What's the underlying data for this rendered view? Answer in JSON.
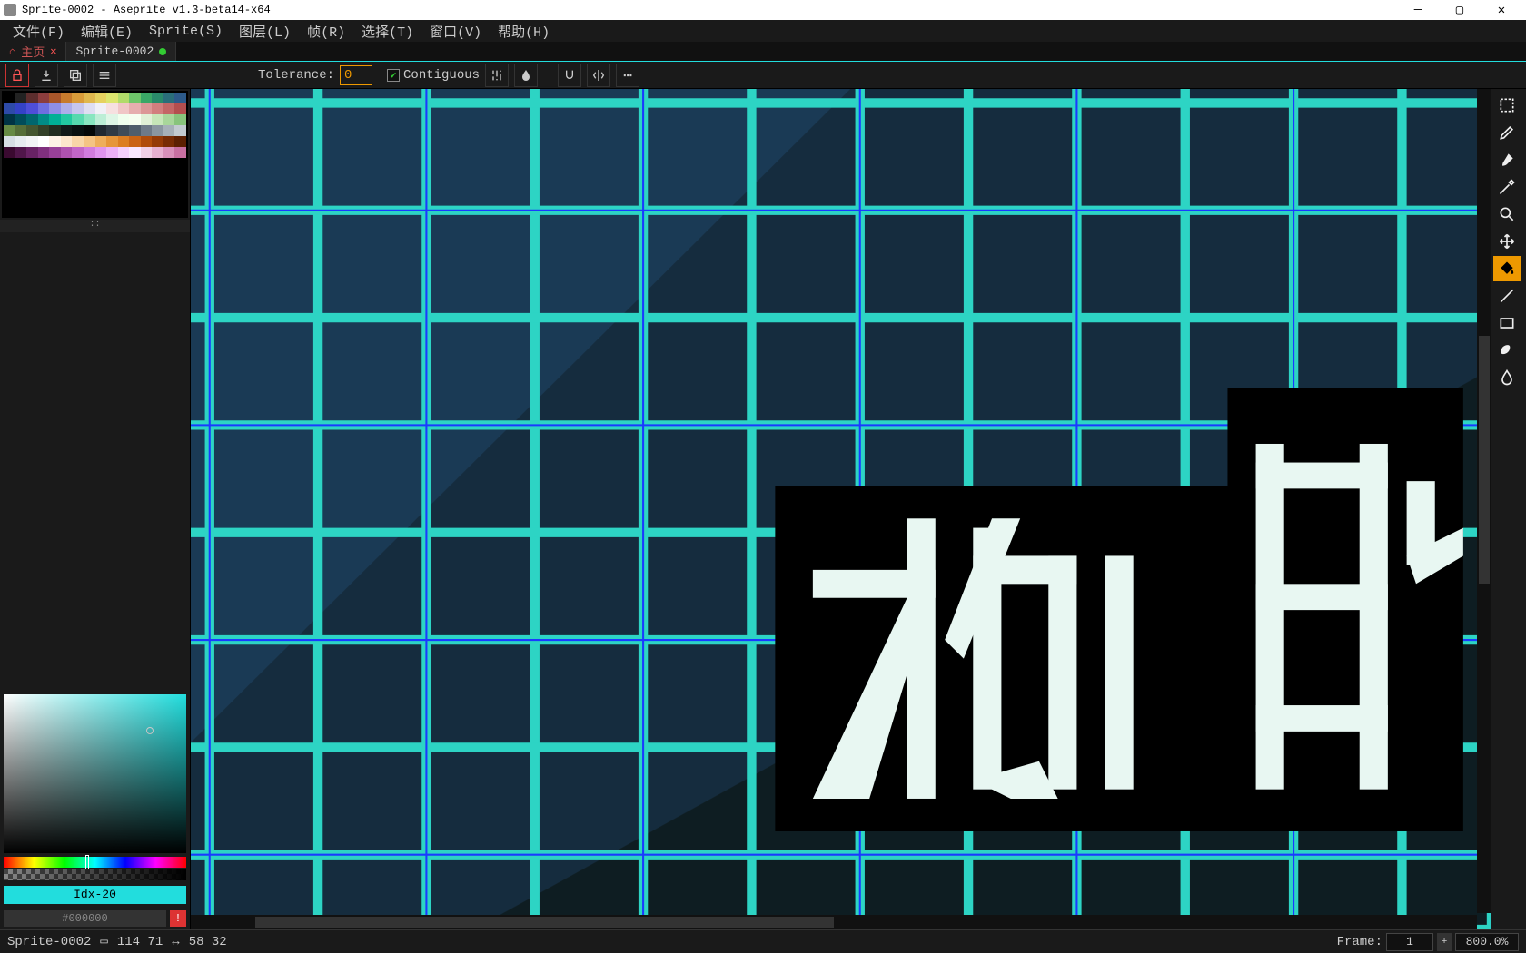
{
  "titlebar": {
    "title": "Sprite-0002 - Aseprite v1.3-beta14-x64"
  },
  "win": {
    "min": "—",
    "max": "▢",
    "close": "✕"
  },
  "menu": [
    "文件(F)",
    "编辑(E)",
    "Sprite(S)",
    "图层(L)",
    "帧(R)",
    "选择(T)",
    "窗口(V)",
    "帮助(H)"
  ],
  "tabs": {
    "home": {
      "label": "主页",
      "close": "✕"
    },
    "active": {
      "label": "Sprite-0002"
    }
  },
  "context": {
    "tolerance_label": "Tolerance:",
    "tolerance_value": "0",
    "contiguous_label": "Contiguous"
  },
  "palette": {
    "handle": "::"
  },
  "colorpanel": {
    "idx_label": "Idx-20",
    "hex": "#000000",
    "warn": "!"
  },
  "status": {
    "sprite": "Sprite-0002",
    "pos": "114 71",
    "sel": "58 32",
    "frame_label": "Frame:",
    "frame": "1",
    "plus": "+",
    "zoom": "800.0%"
  },
  "palette_colors": [
    "#000000",
    "#222222",
    "#5c2d2d",
    "#8b3d3d",
    "#a8562a",
    "#c77b2d",
    "#d99c3a",
    "#e0b84e",
    "#e6d25f",
    "#dce66e",
    "#b1db6a",
    "#6ec56a",
    "#3aa766",
    "#2a8a6a",
    "#2a6e7a",
    "#2d5a8a",
    "#2d4aa8",
    "#3442c7",
    "#4e4ed9",
    "#6e6ee0",
    "#8e8ee6",
    "#aeaeea",
    "#c6c6ee",
    "#dedef2",
    "#f0f0f6",
    "#f6e0e0",
    "#f0c6c6",
    "#e6aeae",
    "#dc9696",
    "#d27e7e",
    "#c46666",
    "#b44e4e",
    "#003344",
    "#004c5a",
    "#00666e",
    "#008b86",
    "#00b096",
    "#22c9a0",
    "#55d9ae",
    "#88e6c0",
    "#bceed6",
    "#def6e6",
    "#f0ffee",
    "#f6fff0",
    "#e0f0d6",
    "#c6e6b8",
    "#a8d69a",
    "#88c47c",
    "#668a44",
    "#556e38",
    "#445630",
    "#334028",
    "#222d20",
    "#111a18",
    "#081010",
    "#040808",
    "#202830",
    "#303a44",
    "#404c58",
    "#505e6c",
    "#6e7a88",
    "#8a96a0",
    "#a6b0b8",
    "#c2cad0",
    "#d6dee4",
    "#e6ecf0",
    "#f2f4f6",
    "#ffffff",
    "#fef2e6",
    "#fce6cc",
    "#f8d6a8",
    "#f4c484",
    "#eeae5c",
    "#e6963a",
    "#dc7e22",
    "#ca6414",
    "#b04c0a",
    "#943a06",
    "#782c04",
    "#5c2002",
    "#3a0a30",
    "#50164a",
    "#682264",
    "#80307e",
    "#984098",
    "#ae52b0",
    "#c266c8",
    "#d27cde",
    "#e094ee",
    "#ecb0f6",
    "#f4d0fc",
    "#f8e8fe",
    "#f0d0e6",
    "#e6b0d0",
    "#d890ba",
    "#c870a2"
  ]
}
